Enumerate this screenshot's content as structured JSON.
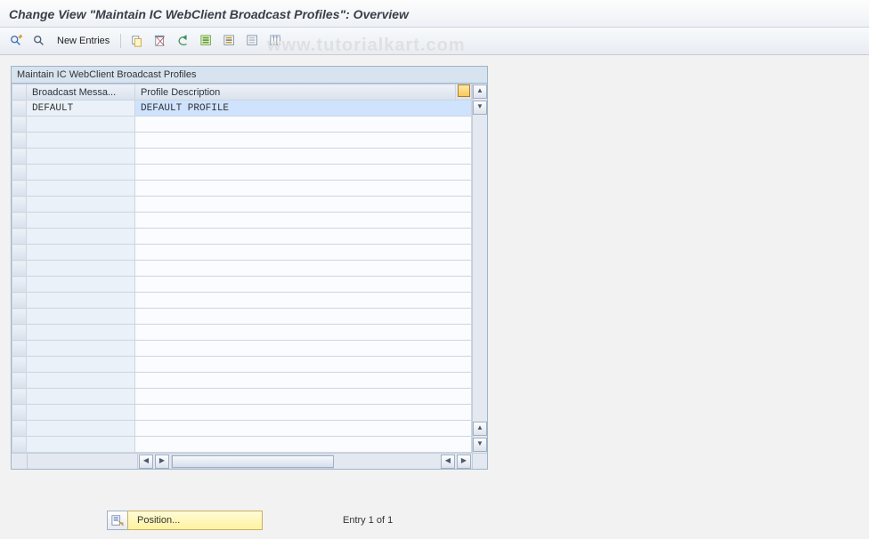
{
  "title": "Change View \"Maintain IC WebClient Broadcast Profiles\": Overview",
  "watermark": "www.tutorialkart.com",
  "toolbar": {
    "new_entries_label": "New Entries"
  },
  "panel": {
    "caption": "Maintain IC WebClient Broadcast Profiles",
    "columns": {
      "col1": "Broadcast Messa...",
      "col2": "Profile Description"
    },
    "rows": [
      {
        "broadcast": "DEFAULT",
        "description": "DEFAULT PROFILE"
      }
    ],
    "empty_row_count": 21
  },
  "footer": {
    "position_label": "Position...",
    "entry_text": "Entry 1 of 1"
  }
}
